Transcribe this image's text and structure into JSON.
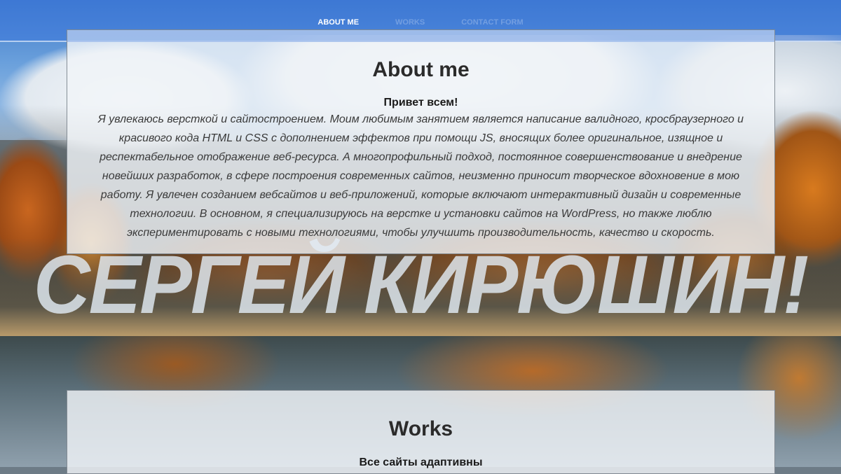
{
  "nav": {
    "items": [
      {
        "label": "ABOUT ME"
      },
      {
        "label": "WORKS"
      },
      {
        "label": "CONTACT FORM"
      }
    ]
  },
  "about": {
    "title": "About me",
    "greeting": "Привет всем!",
    "lines": [
      "Я увлекаюсь версткой и сайтостроением. Моим любимым занятием является написание валидного, кросбраузерного и",
      "красивого кода HTML и CSS с дополнением эффектов при помощи JS, вносящих более оригинальное, изящное и",
      "респектабельное отображение веб-ресурса. А многопрофильный подход, постоянное совершенствование и внедрение",
      "новейших разработок, в сфере построения современных сайтов, неизменно приносит творческое вдохновение в мою",
      "работу. Я увлечен созданием вебсайтов и веб-приложений, которые включают интерактивный дизайн и современные",
      "технологии. В основном, я специализируюсь на верстке и установки сайтов на WordPress, но также люблю",
      "экспериментировать с новыми технологиями, чтобы улучшить производительность, качество и скорость."
    ]
  },
  "hero": {
    "name": "СЕРГЕЙ КИРЮШИН!"
  },
  "works": {
    "title": "Works",
    "subtitle": "Все сайты адаптивны"
  }
}
